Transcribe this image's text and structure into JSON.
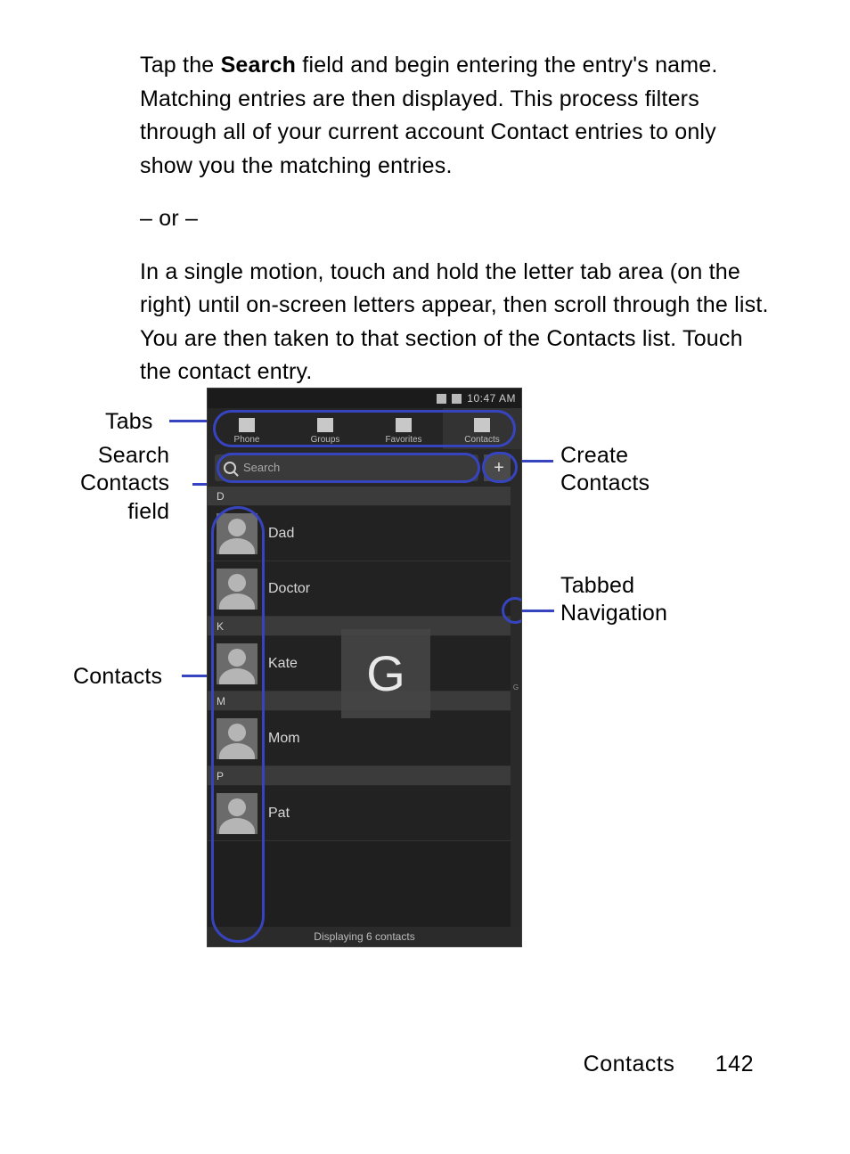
{
  "paragraph1": {
    "before": "Tap the ",
    "bold": "Search",
    "after": " field and begin entering the entry's name. Matching entries are then displayed. This process filters through all of your current account Contact entries to only show you the matching entries."
  },
  "or_text": "– or –",
  "paragraph2": "In a single motion, touch and hold the letter tab area (on the right) until on-screen letters appear, then scroll through the list. You are then taken to that section of the Contacts list. Touch the contact entry.",
  "callouts": {
    "tabs": "Tabs",
    "search_l1": "Search",
    "search_l2": "Contacts",
    "search_l3": "field",
    "contacts": "Contacts",
    "create_l1": "Create",
    "create_l2": "Contacts",
    "tabbed_l1": "Tabbed",
    "tabbed_l2": "Navigation"
  },
  "phone": {
    "time": "10:47 AM",
    "tabs": {
      "phone": "Phone",
      "groups": "Groups",
      "favorites": "Favorites",
      "contacts": "Contacts"
    },
    "search_placeholder": "Search",
    "add_symbol": "+",
    "sections": {
      "d": "D",
      "k": "K",
      "m": "M",
      "p": "P"
    },
    "entries": {
      "dad": "Dad",
      "doctor": "Doctor",
      "kate": "Kate",
      "mom": "Mom",
      "pat": "Pat"
    },
    "big_letter": "G",
    "footer": "Displaying 6 contacts",
    "index_hint": "G"
  },
  "footer": {
    "section": "Contacts",
    "page": "142"
  }
}
